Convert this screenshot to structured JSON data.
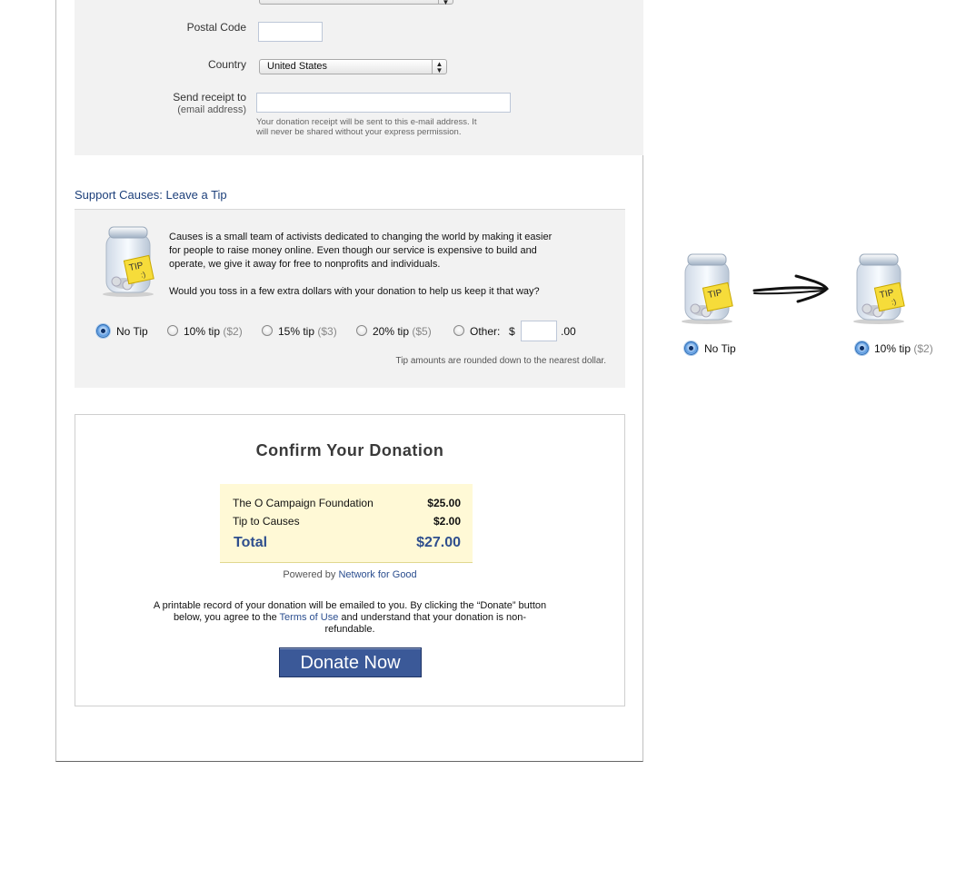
{
  "address_form": {
    "postal_code_label": "Postal Code",
    "postal_code_value": "",
    "country_label": "Country",
    "country_value": "United States",
    "receipt_label": "Send receipt to",
    "receipt_sublabel": "(email address)",
    "receipt_value": "",
    "receipt_hint_line1": "Your donation receipt will be sent to this e-mail address. It",
    "receipt_hint_line2": "will never be shared without your express permission."
  },
  "tip_section": {
    "heading": "Support Causes: Leave a Tip",
    "jar_label": "TIP",
    "description_lines": [
      "Causes is a small team of activists dedicated to changing the world by making it easier",
      "for people to raise money online. Even though our service is expensive to build and",
      "operate, we give it away for free to nonprofits and individuals."
    ],
    "question": "Would you toss in a few extra dollars with your donation to help us keep it that way?",
    "options": [
      {
        "label": "No Tip",
        "amount": "",
        "selected": true
      },
      {
        "label": "10% tip",
        "amount": "($2)",
        "selected": false
      },
      {
        "label": "15% tip",
        "amount": "($3)",
        "selected": false
      },
      {
        "label": "20% tip",
        "amount": "($5)",
        "selected": false
      },
      {
        "label": "Other:",
        "amount": "",
        "selected": false
      }
    ],
    "currency_symbol": "$",
    "other_value": "",
    "cents_suffix": ".00",
    "rounding_note": "Tip amounts are rounded down to the nearest dollar."
  },
  "confirm": {
    "title": "Confirm Your Donation",
    "rows": [
      {
        "label": "The O Campaign Foundation",
        "value": "$25.00"
      },
      {
        "label": "Tip to Causes",
        "value": "$2.00"
      }
    ],
    "total_label": "Total",
    "total_value": "$27.00",
    "powered_prefix": "Powered by",
    "powered_link": "Network for Good",
    "legal_line1": "A printable record of your donation will be emailed to you. By clicking the “Donate” button",
    "legal_line2_prefix": "below, you agree to the",
    "legal_link": "Terms of Use",
    "legal_line2_suffix": "and understand that your donation is non-",
    "legal_line3": "refundable.",
    "donate_label": "Donate Now"
  },
  "annotation": {
    "jar_label": "TIP",
    "before_label": "No Tip",
    "after_label": "10% tip",
    "after_amount": "($2)"
  },
  "colors": {
    "heading_blue": "#1c3f7a",
    "link_blue": "#2b4e8f",
    "button_blue": "#3b5998",
    "summary_bg": "#fff9d6",
    "panel_gray": "#f2f2f2"
  }
}
